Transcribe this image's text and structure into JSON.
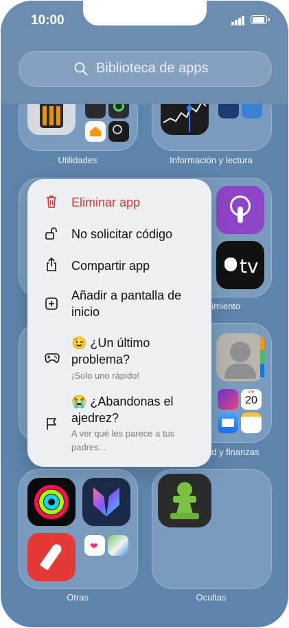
{
  "status": {
    "time": "10:00"
  },
  "search": {
    "placeholder": "Biblioteca de apps"
  },
  "folders": {
    "utilidades": "Utilidades",
    "informacion": "Información y lectura",
    "entretenimiento_partial": "nimiento",
    "productividad_partial": "ad y finanzas",
    "otras": "Otras",
    "ocultas": "Ocultas"
  },
  "calendar": {
    "day_abbr": "vie",
    "day_number": "20"
  },
  "menu": {
    "items": [
      {
        "label": "Eliminar app",
        "icon": "trash-icon",
        "color": "#e0352e"
      },
      {
        "label": "No solicitar código",
        "icon": "unlock-icon"
      },
      {
        "label": "Compartir app",
        "icon": "share-icon"
      },
      {
        "label": "Añadir a pantalla de inicio",
        "icon": "add-square-icon"
      },
      {
        "label": "😉 ¿Un último problema?",
        "sublabel": "¡Solo uno rápido!",
        "icon": "gamepad-icon"
      },
      {
        "label": "😭 ¿Abandonas el ajedrez?",
        "sublabel": "A ver qué les parece a tus padres...",
        "icon": "flag-icon"
      }
    ]
  },
  "colors": {
    "wallpaper": "#5d84ab",
    "destructive": "#e0352e"
  }
}
